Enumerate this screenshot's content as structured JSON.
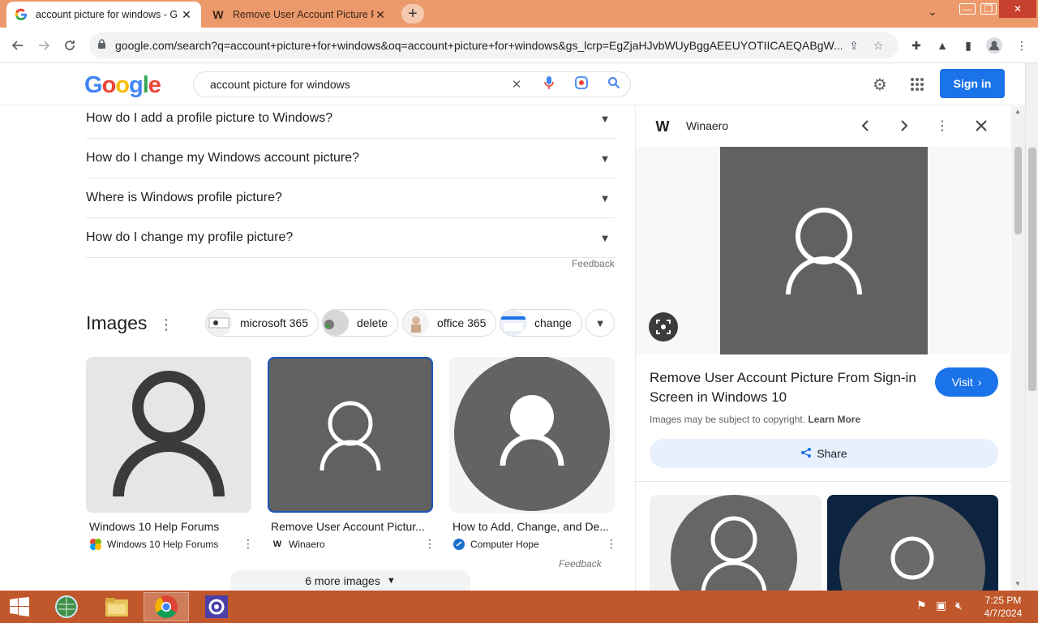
{
  "tabs": [
    {
      "title": "account picture for windows - G",
      "favicon": "G"
    },
    {
      "title": "Remove User Account Picture Fr",
      "favicon": "W"
    }
  ],
  "address": {
    "url": "google.com/search?q=account+picture+for+windows&oq=account+picture+for+windows&gs_lcrp=EgZjaHJvbWUyBggAEEUYOTIICAEQABgW..."
  },
  "google": {
    "logo": "Google",
    "query": "account picture for windows",
    "signin": "Sign in"
  },
  "faq": [
    "How do I add a profile picture to Windows?",
    "How do I change my Windows account picture?",
    "Where is Windows profile picture?",
    "How do I change my profile picture?"
  ],
  "feedback": "Feedback",
  "images": {
    "title": "Images",
    "chips": [
      "microsoft 365",
      "delete",
      "office 365",
      "change"
    ],
    "results": [
      {
        "caption": "Windows 10 Help Forums",
        "source": "Windows 10 Help Forums",
        "favicon": "windows-logo-icon"
      },
      {
        "caption": "Remove User Account Pictur...",
        "source": "Winaero",
        "favicon": "W"
      },
      {
        "caption": "How to Add, Change, and De...",
        "source": "Computer Hope",
        "favicon": "computer-hope-icon"
      }
    ],
    "feedback": "Feedback",
    "more": "6 more images"
  },
  "panel": {
    "site": "Winaero",
    "favicon": "W",
    "title": "Remove User Account Picture From Sign-in Screen in Windows 10",
    "visit": "Visit",
    "copyright": "Images may be subject to copyright.",
    "learn_more": "Learn More",
    "share": "Share"
  },
  "taskbar": {
    "time": "7:25 PM",
    "date": "4/7/2024"
  },
  "colors": {
    "titlebar": "#ec9a6c",
    "taskbar": "#c0582b",
    "accent": "#1a73e8"
  }
}
